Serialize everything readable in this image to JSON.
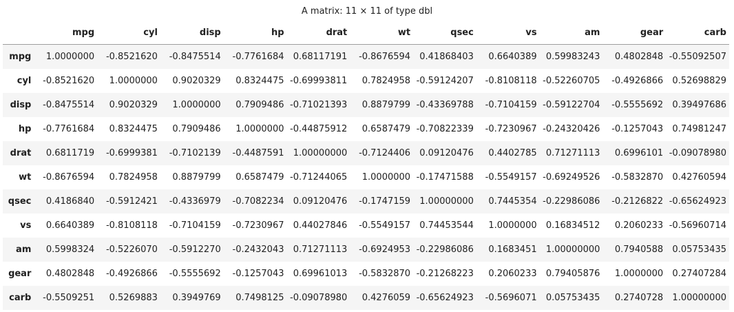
{
  "caption": "A matrix: 11 × 11 of type dbl",
  "columns": [
    "mpg",
    "cyl",
    "disp",
    "hp",
    "drat",
    "wt",
    "qsec",
    "vs",
    "am",
    "gear",
    "carb"
  ],
  "rows": [
    {
      "name": "mpg",
      "values": [
        "1.0000000",
        "-0.8521620",
        "-0.8475514",
        "-0.7761684",
        "0.68117191",
        "-0.8676594",
        "0.41868403",
        "0.6640389",
        "0.59983243",
        "0.4802848",
        "-0.55092507"
      ]
    },
    {
      "name": "cyl",
      "values": [
        "-0.8521620",
        "1.0000000",
        "0.9020329",
        "0.8324475",
        "-0.69993811",
        "0.7824958",
        "-0.59124207",
        "-0.8108118",
        "-0.52260705",
        "-0.4926866",
        "0.52698829"
      ]
    },
    {
      "name": "disp",
      "values": [
        "-0.8475514",
        "0.9020329",
        "1.0000000",
        "0.7909486",
        "-0.71021393",
        "0.8879799",
        "-0.43369788",
        "-0.7104159",
        "-0.59122704",
        "-0.5555692",
        "0.39497686"
      ]
    },
    {
      "name": "hp",
      "values": [
        "-0.7761684",
        "0.8324475",
        "0.7909486",
        "1.0000000",
        "-0.44875912",
        "0.6587479",
        "-0.70822339",
        "-0.7230967",
        "-0.24320426",
        "-0.1257043",
        "0.74981247"
      ]
    },
    {
      "name": "drat",
      "values": [
        "0.6811719",
        "-0.6999381",
        "-0.7102139",
        "-0.4487591",
        "1.00000000",
        "-0.7124406",
        "0.09120476",
        "0.4402785",
        "0.71271113",
        "0.6996101",
        "-0.09078980"
      ]
    },
    {
      "name": "wt",
      "values": [
        "-0.8676594",
        "0.7824958",
        "0.8879799",
        "0.6587479",
        "-0.71244065",
        "1.0000000",
        "-0.17471588",
        "-0.5549157",
        "-0.69249526",
        "-0.5832870",
        "0.42760594"
      ]
    },
    {
      "name": "qsec",
      "values": [
        "0.4186840",
        "-0.5912421",
        "-0.4336979",
        "-0.7082234",
        "0.09120476",
        "-0.1747159",
        "1.00000000",
        "0.7445354",
        "-0.22986086",
        "-0.2126822",
        "-0.65624923"
      ]
    },
    {
      "name": "vs",
      "values": [
        "0.6640389",
        "-0.8108118",
        "-0.7104159",
        "-0.7230967",
        "0.44027846",
        "-0.5549157",
        "0.74453544",
        "1.0000000",
        "0.16834512",
        "0.2060233",
        "-0.56960714"
      ]
    },
    {
      "name": "am",
      "values": [
        "0.5998324",
        "-0.5226070",
        "-0.5912270",
        "-0.2432043",
        "0.71271113",
        "-0.6924953",
        "-0.22986086",
        "0.1683451",
        "1.00000000",
        "0.7940588",
        "0.05753435"
      ]
    },
    {
      "name": "gear",
      "values": [
        "0.4802848",
        "-0.4926866",
        "-0.5555692",
        "-0.1257043",
        "0.69961013",
        "-0.5832870",
        "-0.21268223",
        "0.2060233",
        "0.79405876",
        "1.0000000",
        "0.27407284"
      ]
    },
    {
      "name": "carb",
      "values": [
        "-0.5509251",
        "0.5269883",
        "0.3949769",
        "0.7498125",
        "-0.09078980",
        "0.4276059",
        "-0.65624923",
        "-0.5696071",
        "0.05753435",
        "0.2740728",
        "1.00000000"
      ]
    }
  ]
}
